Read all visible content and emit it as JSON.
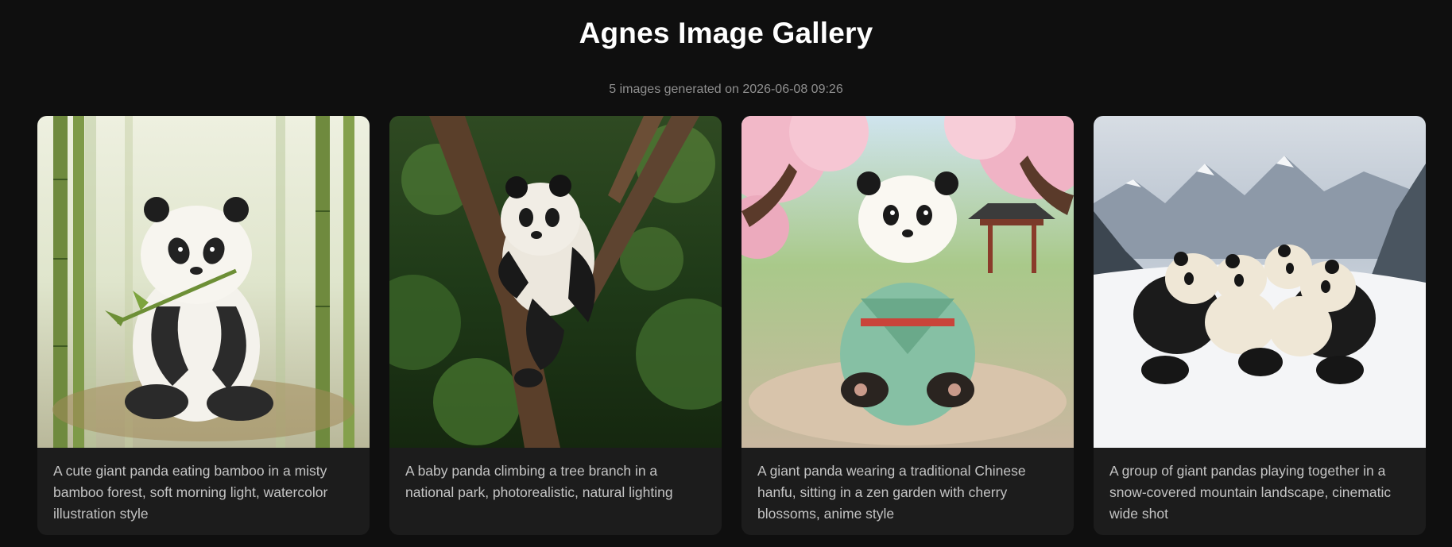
{
  "header": {
    "title": "Agnes Image Gallery",
    "subtitle": "5 images generated on 2026-06-08 09:26"
  },
  "gallery": {
    "items": [
      {
        "caption": "A cute giant panda eating bamboo in a misty bamboo forest, soft morning light, watercolor illustration style",
        "scene": "watercolor-bamboo"
      },
      {
        "caption": "A baby panda climbing a tree branch in a national park, photorealistic, natural lighting",
        "scene": "forest-tree"
      },
      {
        "caption": "A giant panda wearing a traditional Chinese hanfu, sitting in a zen garden with cherry blossoms, anime style",
        "scene": "cherry-garden"
      },
      {
        "caption": "A group of giant pandas playing together in a snow-covered mountain landscape, cinematic wide shot",
        "scene": "snow-mountains"
      }
    ]
  },
  "colors": {
    "background": "#0f0f0f",
    "card": "#1c1c1c",
    "title": "#ffffff",
    "subtitle": "#8f8f8f",
    "caption": "#c4c4c4"
  }
}
